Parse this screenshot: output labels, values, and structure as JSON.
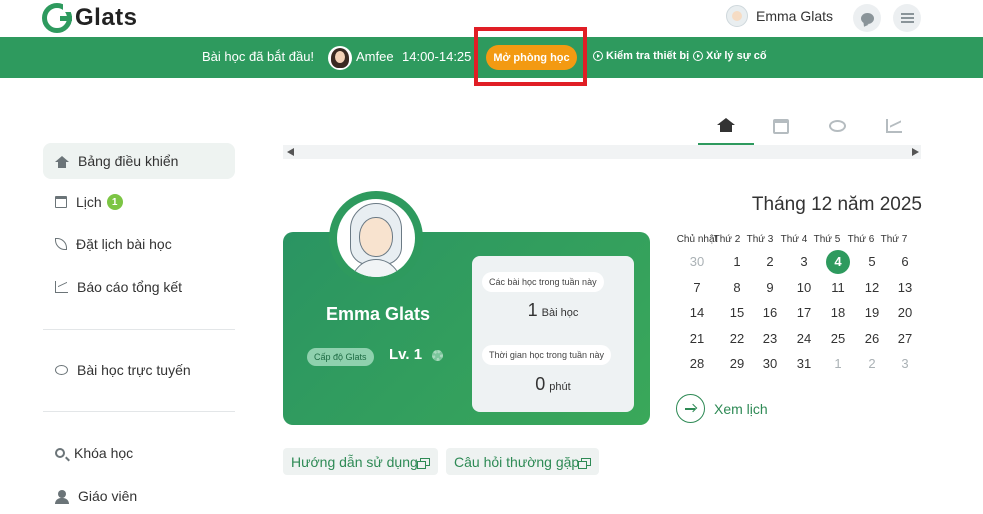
{
  "header": {
    "logo_text": "Glats",
    "user_name": "Emma Glats",
    "icons": {
      "chat": "chat-bubble-icon",
      "menu": "hamburger-menu-icon"
    }
  },
  "banner": {
    "message": "Bài học đã bắt đầu!",
    "teacher_name": "Amfee",
    "time": "14:00-14:25",
    "open_room_label": "Mở phòng học",
    "check_device_label": "Kiểm tra thiết bị",
    "troubleshoot_label": "Xử lý sự cố"
  },
  "sidebar": {
    "items": [
      {
        "label": "Bảng điều khiển",
        "icon": "home-icon",
        "active": true
      },
      {
        "label": "Lịch",
        "icon": "calendar-icon",
        "badge": "1"
      },
      {
        "label": "Đặt lịch bài học",
        "icon": "leaf-icon"
      },
      {
        "label": "Báo cáo tổng kết",
        "icon": "chart-icon"
      },
      {
        "label": "Bài học trực tuyến",
        "icon": "chat-icon"
      },
      {
        "label": "Khóa học",
        "icon": "search-icon"
      },
      {
        "label": "Giáo viên",
        "icon": "teacher-icon"
      }
    ]
  },
  "tabs": [
    "home-icon",
    "calendar-icon",
    "chat-icon",
    "chart-icon"
  ],
  "profile": {
    "name": "Emma Glats",
    "level_badge": "Cấp độ Glats",
    "level": "Lv. 1",
    "weekly_lessons_label": "Các bài học trong tuần này",
    "weekly_lessons_value": "1",
    "weekly_lessons_unit": "Bài học",
    "weekly_time_label": "Thời gian học trong tuần này",
    "weekly_time_value": "0",
    "weekly_time_unit": "phút"
  },
  "help": {
    "guide_label": "Hướng dẫn sử dụng",
    "faq_label": "Câu hỏi thường gặp"
  },
  "calendar": {
    "title": "Tháng 12 năm 2025",
    "weekdays": [
      "Chủ nhật",
      "Thứ 2",
      "Thứ 3",
      "Thứ 4",
      "Thứ 5",
      "Thứ 6",
      "Thứ 7"
    ],
    "weeks": [
      [
        "30",
        "1",
        "2",
        "3",
        "4",
        "5",
        "6"
      ],
      [
        "7",
        "8",
        "9",
        "10",
        "11",
        "12",
        "13"
      ],
      [
        "14",
        "15",
        "16",
        "17",
        "18",
        "19",
        "20"
      ],
      [
        "21",
        "22",
        "23",
        "24",
        "25",
        "26",
        "27"
      ],
      [
        "28",
        "29",
        "30",
        "31",
        "1",
        "2",
        "3"
      ]
    ],
    "today": "4",
    "view_label": "Xem lịch"
  },
  "colors": {
    "brand": "#2e9a5e",
    "accent": "#f39a12",
    "highlight": "#e01e25"
  }
}
